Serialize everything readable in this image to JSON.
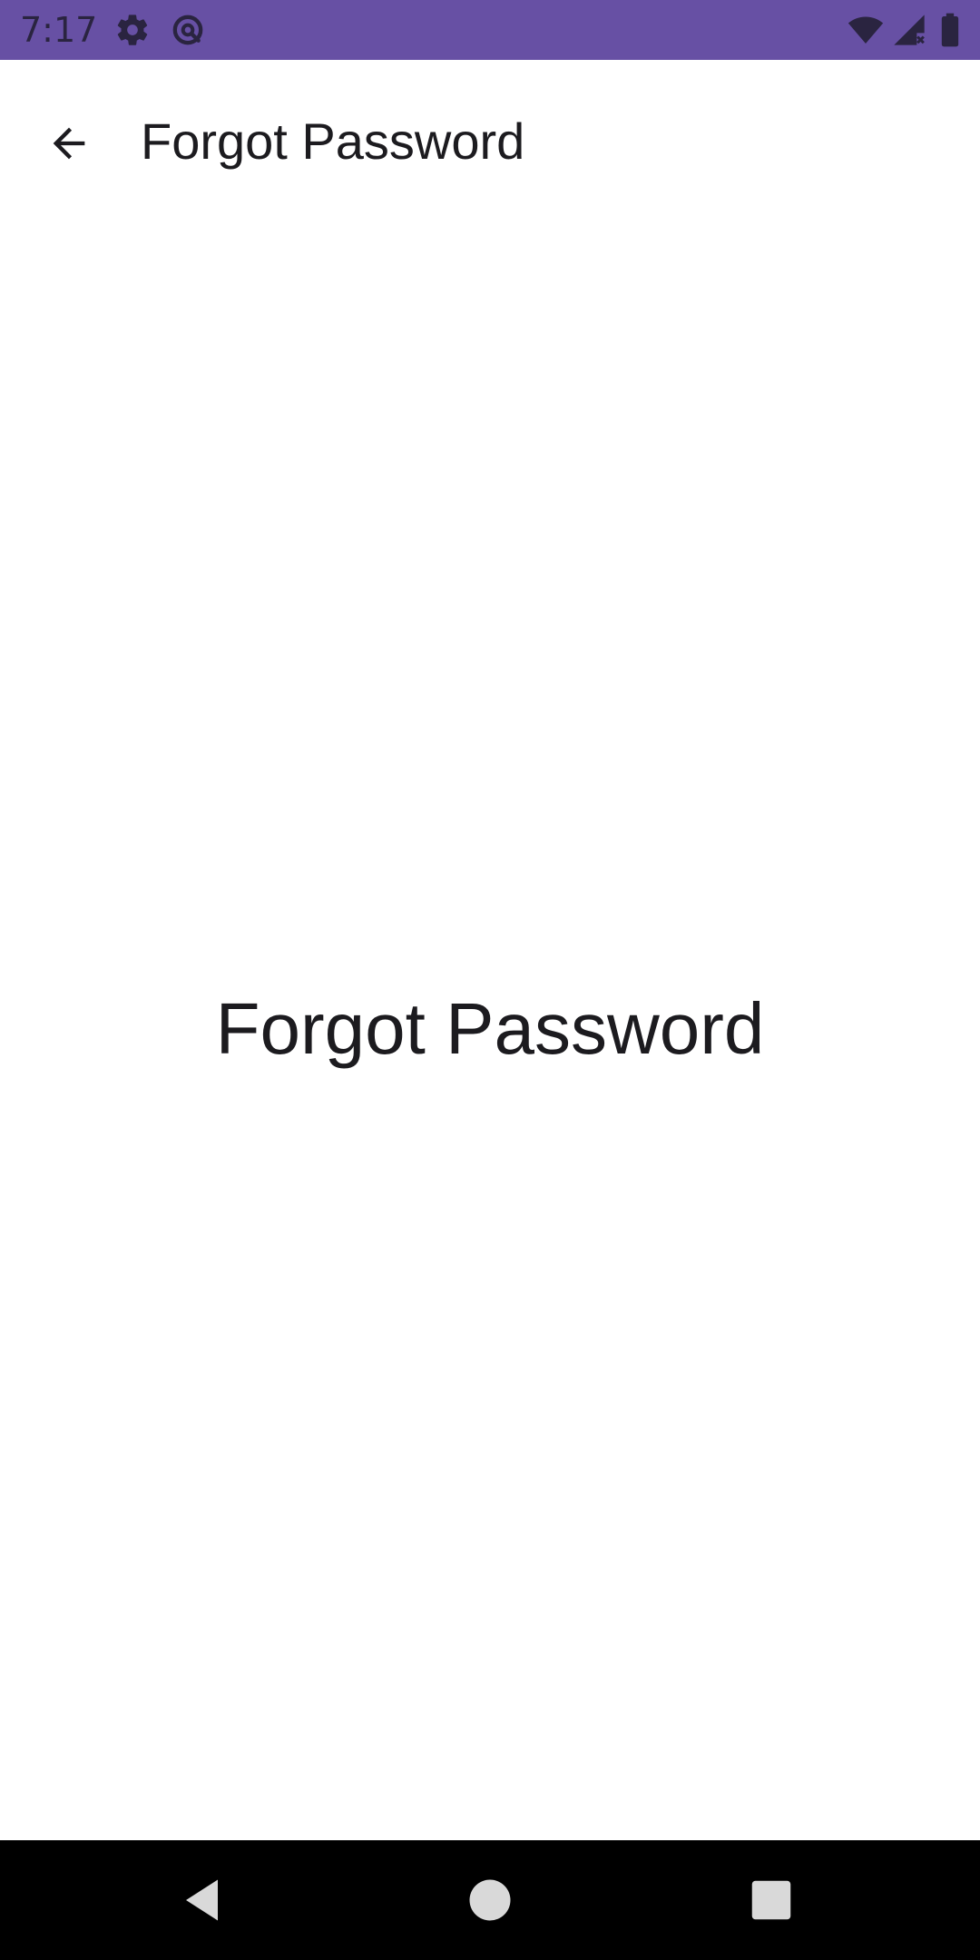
{
  "status_bar": {
    "time": "7:17",
    "background_color": "#6750a4",
    "icons": [
      "gear-icon",
      "data-saver-icon",
      "wifi-icon",
      "cellular-signal-icon",
      "battery-icon"
    ]
  },
  "app_bar": {
    "title": "Forgot Password",
    "back_icon": "arrow-back-icon"
  },
  "content": {
    "heading": "Forgot Password"
  },
  "nav_bar": {
    "icons": [
      "back-triangle-icon",
      "home-circle-icon",
      "recents-square-icon"
    ]
  }
}
